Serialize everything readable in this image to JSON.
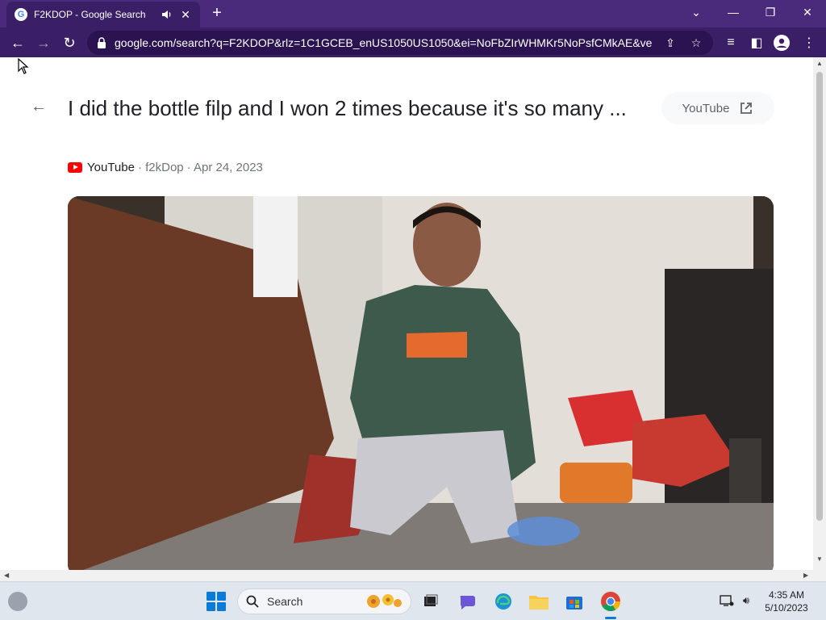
{
  "browser": {
    "tab_title": "F2KDOP - Google Search",
    "tab_favicon": "G",
    "url": "google.com/search?q=F2KDOP&rlz=1C1GCEB_enUS1050US1050&ei=NoFbZIrWHMKr5NoPsfCMkAE&ved...",
    "new_tab_label": "+"
  },
  "page": {
    "title": "I did the bottle filp and I won 2 times because it's so many ...",
    "source_chip_label": "YouTube",
    "meta_source": "YouTube",
    "meta_channel": "· f2kDop",
    "meta_date": "· Apr 24, 2023"
  },
  "taskbar": {
    "search_label": "Search",
    "time": "4:35 AM",
    "date": "5/10/2023"
  },
  "colors": {
    "tab_strip": "#4a2a7a",
    "toolbar": "#3b1f66",
    "accent": "#0a7cd8",
    "youtube_red": "#ff0000"
  }
}
